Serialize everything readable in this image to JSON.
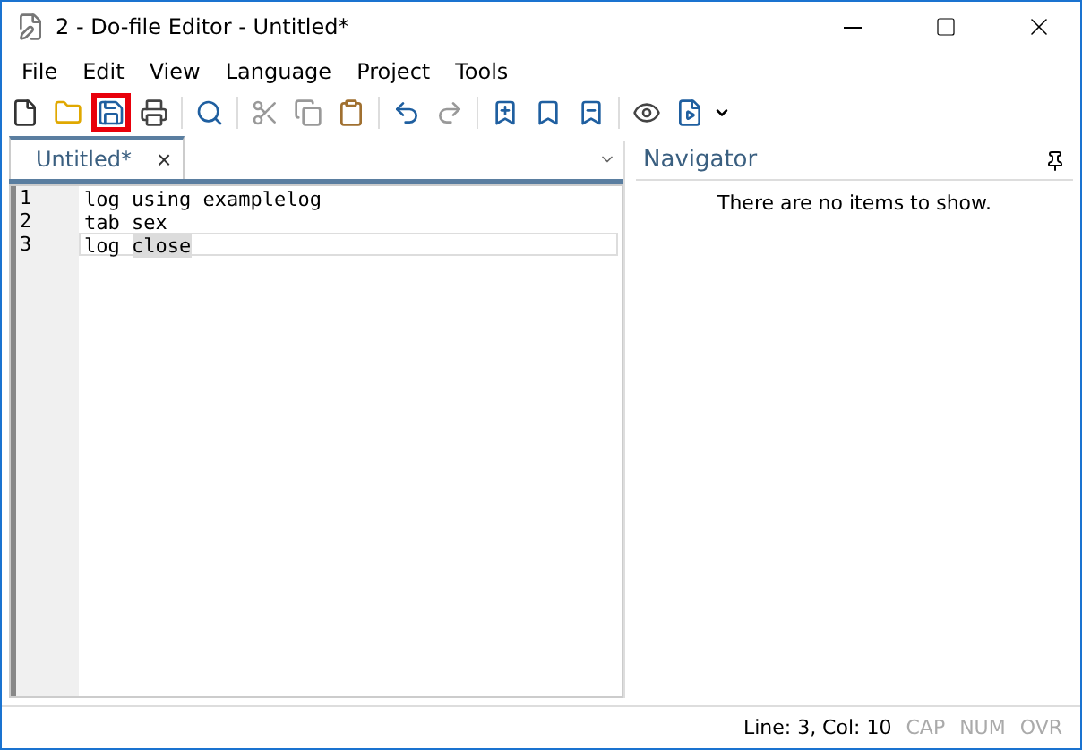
{
  "window": {
    "title": "2 - Do-file Editor - Untitled*"
  },
  "menu": [
    "File",
    "Edit",
    "View",
    "Language",
    "Project",
    "Tools"
  ],
  "toolbar": [
    {
      "kind": "new",
      "highlighted": false
    },
    {
      "kind": "open",
      "highlighted": false
    },
    {
      "kind": "save",
      "highlighted": true
    },
    {
      "kind": "print",
      "highlighted": false
    },
    {
      "kind": "sep"
    },
    {
      "kind": "find",
      "highlighted": false
    },
    {
      "kind": "sep"
    },
    {
      "kind": "cut",
      "highlighted": false
    },
    {
      "kind": "copy",
      "highlighted": false
    },
    {
      "kind": "paste",
      "highlighted": false
    },
    {
      "kind": "sep"
    },
    {
      "kind": "undo",
      "highlighted": false
    },
    {
      "kind": "redo",
      "highlighted": false
    },
    {
      "kind": "sep"
    },
    {
      "kind": "bookmark",
      "highlighted": false
    },
    {
      "kind": "bookmark-prev",
      "highlighted": false
    },
    {
      "kind": "bookmark-next",
      "highlighted": false
    },
    {
      "kind": "sep"
    },
    {
      "kind": "preview",
      "highlighted": false
    },
    {
      "kind": "run",
      "highlighted": false
    }
  ],
  "tabs": [
    {
      "label": "Untitled*",
      "selected": true,
      "close": "×"
    }
  ],
  "editor": {
    "lines": [
      {
        "number": "1",
        "current": false,
        "segments": [
          {
            "text": "log using examplelog",
            "selected": false
          }
        ]
      },
      {
        "number": "2",
        "current": false,
        "segments": [
          {
            "text": "tab sex",
            "selected": false
          }
        ]
      },
      {
        "number": "3",
        "current": true,
        "segments": [
          {
            "text": "log ",
            "selected": false
          },
          {
            "text": "close",
            "selected": true
          }
        ]
      }
    ]
  },
  "navigator": {
    "title": "Navigator",
    "empty_message": "There are no items to show."
  },
  "status_bar": {
    "position": "Line: 3, Col: 10",
    "indicators": [
      {
        "label": "CAP",
        "on": false
      },
      {
        "label": "NUM",
        "on": false
      },
      {
        "label": "OVR",
        "on": false
      }
    ]
  }
}
